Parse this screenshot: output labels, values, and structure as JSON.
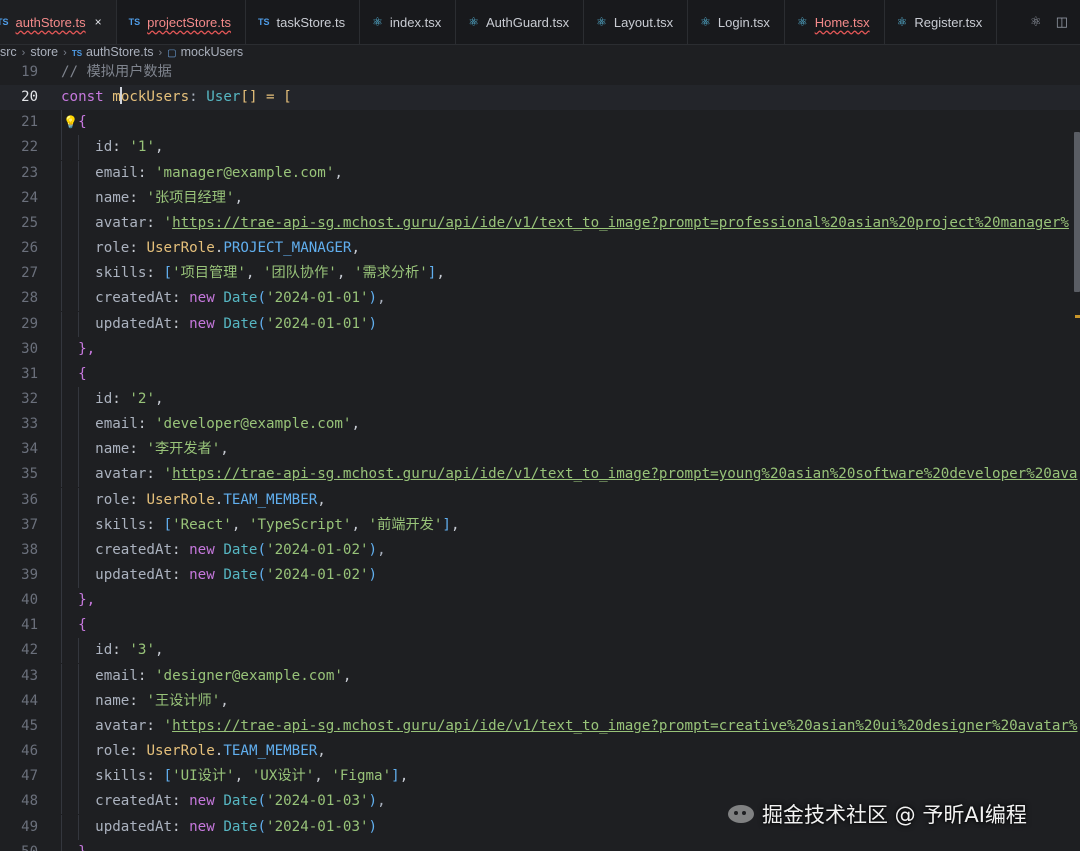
{
  "tabs": [
    {
      "label": "authStore.ts",
      "icon": "ts-icon",
      "icon_text": "TS",
      "active": true,
      "error": true,
      "close": "×"
    },
    {
      "label": "projectStore.ts",
      "icon": "ts-icon",
      "icon_text": "TS",
      "active": false,
      "error": true
    },
    {
      "label": "taskStore.ts",
      "icon": "ts-icon",
      "icon_text": "TS",
      "active": false,
      "error": false
    },
    {
      "label": "index.tsx",
      "icon": "react-icon",
      "icon_text": "⚛",
      "active": false,
      "error": false
    },
    {
      "label": "AuthGuard.tsx",
      "icon": "react-icon",
      "icon_text": "⚛",
      "active": false,
      "error": false
    },
    {
      "label": "Layout.tsx",
      "icon": "react-icon",
      "icon_text": "⚛",
      "active": false,
      "error": false
    },
    {
      "label": "Login.tsx",
      "icon": "react-icon",
      "icon_text": "⚛",
      "active": false,
      "error": false
    },
    {
      "label": "Home.tsx",
      "icon": "react-icon",
      "icon_text": "⚛",
      "active": false,
      "error": true
    },
    {
      "label": "Register.tsx",
      "icon": "react-icon",
      "icon_text": "⚛",
      "active": false,
      "error": false
    }
  ],
  "breadcrumb": [
    "src",
    "store",
    "authStore.ts",
    "mockUsers"
  ],
  "editor": {
    "current_line": 20,
    "lines": [
      {
        "n": 19,
        "comment": "// 模拟用户数据"
      },
      {
        "n": 20,
        "kw": "const",
        "before_cursor": "m",
        "var": "ockUsers",
        "type": "User",
        "rest": "[] = ["
      },
      {
        "n": 21,
        "open": "{"
      },
      {
        "n": 22,
        "key": "id",
        "value": "'1'"
      },
      {
        "n": 23,
        "key": "email",
        "value": "'manager@example.com'"
      },
      {
        "n": 24,
        "key": "name",
        "value": "'张项目经理'"
      },
      {
        "n": 25,
        "key": "avatar",
        "quote": "'",
        "url": "https://trae-api-sg.mchost.guru/api/ide/v1/text_to_image?prompt=professional%20asian%20project%20manager%"
      },
      {
        "n": 26,
        "key": "role",
        "enum": "UserRole",
        "member": "PROJECT_MANAGER"
      },
      {
        "n": 27,
        "key": "skills",
        "items": [
          "'项目管理'",
          "'团队协作'",
          "'需求分析'"
        ]
      },
      {
        "n": 28,
        "key": "createdAt",
        "kw": "new",
        "ctor": "Date",
        "arg": "'2024-01-01'",
        "trail": ","
      },
      {
        "n": 29,
        "key": "updatedAt",
        "kw": "new",
        "ctor": "Date",
        "arg": "'2024-01-01'",
        "trail": ""
      },
      {
        "n": 30,
        "close": "},"
      },
      {
        "n": 31,
        "open": "{"
      },
      {
        "n": 32,
        "key": "id",
        "value": "'2'"
      },
      {
        "n": 33,
        "key": "email",
        "value": "'developer@example.com'"
      },
      {
        "n": 34,
        "key": "name",
        "value": "'李开发者'"
      },
      {
        "n": 35,
        "key": "avatar",
        "quote": "'",
        "url": "https://trae-api-sg.mchost.guru/api/ide/v1/text_to_image?prompt=young%20asian%20software%20developer%20ava"
      },
      {
        "n": 36,
        "key": "role",
        "enum": "UserRole",
        "member": "TEAM_MEMBER"
      },
      {
        "n": 37,
        "key": "skills",
        "items": [
          "'React'",
          "'TypeScript'",
          "'前端开发'"
        ]
      },
      {
        "n": 38,
        "key": "createdAt",
        "kw": "new",
        "ctor": "Date",
        "arg": "'2024-01-02'",
        "trail": ","
      },
      {
        "n": 39,
        "key": "updatedAt",
        "kw": "new",
        "ctor": "Date",
        "arg": "'2024-01-02'",
        "trail": ""
      },
      {
        "n": 40,
        "close": "},"
      },
      {
        "n": 41,
        "open": "{"
      },
      {
        "n": 42,
        "key": "id",
        "value": "'3'"
      },
      {
        "n": 43,
        "key": "email",
        "value": "'designer@example.com'"
      },
      {
        "n": 44,
        "key": "name",
        "value": "'王设计师'"
      },
      {
        "n": 45,
        "key": "avatar",
        "quote": "'",
        "url": "https://trae-api-sg.mchost.guru/api/ide/v1/text_to_image?prompt=creative%20asian%20ui%20designer%20avatar%"
      },
      {
        "n": 46,
        "key": "role",
        "enum": "UserRole",
        "member": "TEAM_MEMBER"
      },
      {
        "n": 47,
        "key": "skills",
        "items": [
          "'UI设计'",
          "'UX设计'",
          "'Figma'"
        ]
      },
      {
        "n": 48,
        "key": "createdAt",
        "kw": "new",
        "ctor": "Date",
        "arg": "'2024-01-03'",
        "trail": ","
      },
      {
        "n": 49,
        "key": "updatedAt",
        "kw": "new",
        "ctor": "Date",
        "arg": "'2024-01-03'",
        "trail": ""
      },
      {
        "n": 50,
        "close": "},"
      }
    ]
  },
  "watermark": "掘金技术社区 @ 予昕AI编程",
  "colors": {
    "keyword": "#c678dd",
    "type": "#56b6c2",
    "string": "#98c379",
    "function": "#61afef",
    "variable": "#e5c07b",
    "comment": "#7f848e"
  }
}
